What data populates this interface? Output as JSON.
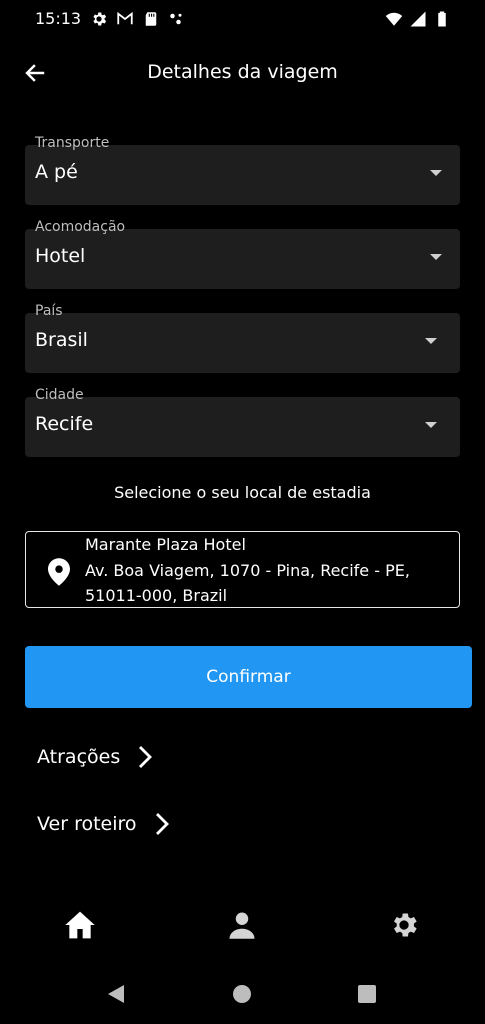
{
  "status": {
    "time": "15:13",
    "left_icons": [
      "gear-icon",
      "gmail-icon",
      "sd-card-icon",
      "dots-icon"
    ],
    "right_icons": [
      "wifi-icon",
      "signal-icon",
      "battery-icon"
    ]
  },
  "header": {
    "title": "Detalhes da viagem",
    "back_icon": "arrow-left-icon"
  },
  "form": {
    "transport": {
      "label": "Transporte",
      "value": "A pé"
    },
    "lodging": {
      "label": "Acomodação",
      "value": "Hotel"
    },
    "country": {
      "label": "País",
      "value": "Brasil"
    },
    "city": {
      "label": "Cidade",
      "value": "Recife"
    }
  },
  "stay": {
    "prompt": "Selecione o seu local de estadia",
    "name": "Marante Plaza Hotel",
    "address": "Av. Boa Viagem, 1070 - Pina, Recife - PE, 51011-000, Brazil"
  },
  "actions": {
    "confirm": "Confirmar",
    "attractions": "Atrações",
    "itinerary": "Ver roteiro"
  },
  "bottom_nav": [
    "home-icon",
    "person-icon",
    "settings-icon"
  ],
  "colors": {
    "accent": "#2196f3",
    "field_bg": "#1e1e1e",
    "background": "#000000"
  }
}
